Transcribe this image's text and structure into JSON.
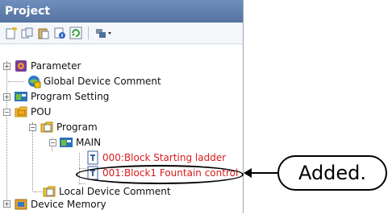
{
  "panel": {
    "title": "Project"
  },
  "toolbar": {
    "icons": [
      "new-data-icon",
      "copy-icon",
      "paste-icon",
      "properties-icon",
      "refresh-icon",
      "settings-dropdown-icon"
    ]
  },
  "tree": {
    "parameter": "Parameter",
    "global_device_comment": "Global Device Comment",
    "program_setting": "Program Setting",
    "pou": "POU",
    "program": "Program",
    "main": "MAIN",
    "ladder_000": "000:Block Starting ladder",
    "ladder_001": "001:Block1 Fountain control",
    "local_device_comment": "Local Device Comment",
    "device_memory": "Device Memory"
  },
  "annotation": {
    "text": "Added."
  },
  "colors": {
    "title_bar": "#5f7fae",
    "new_item_text": "#d81b1b"
  }
}
